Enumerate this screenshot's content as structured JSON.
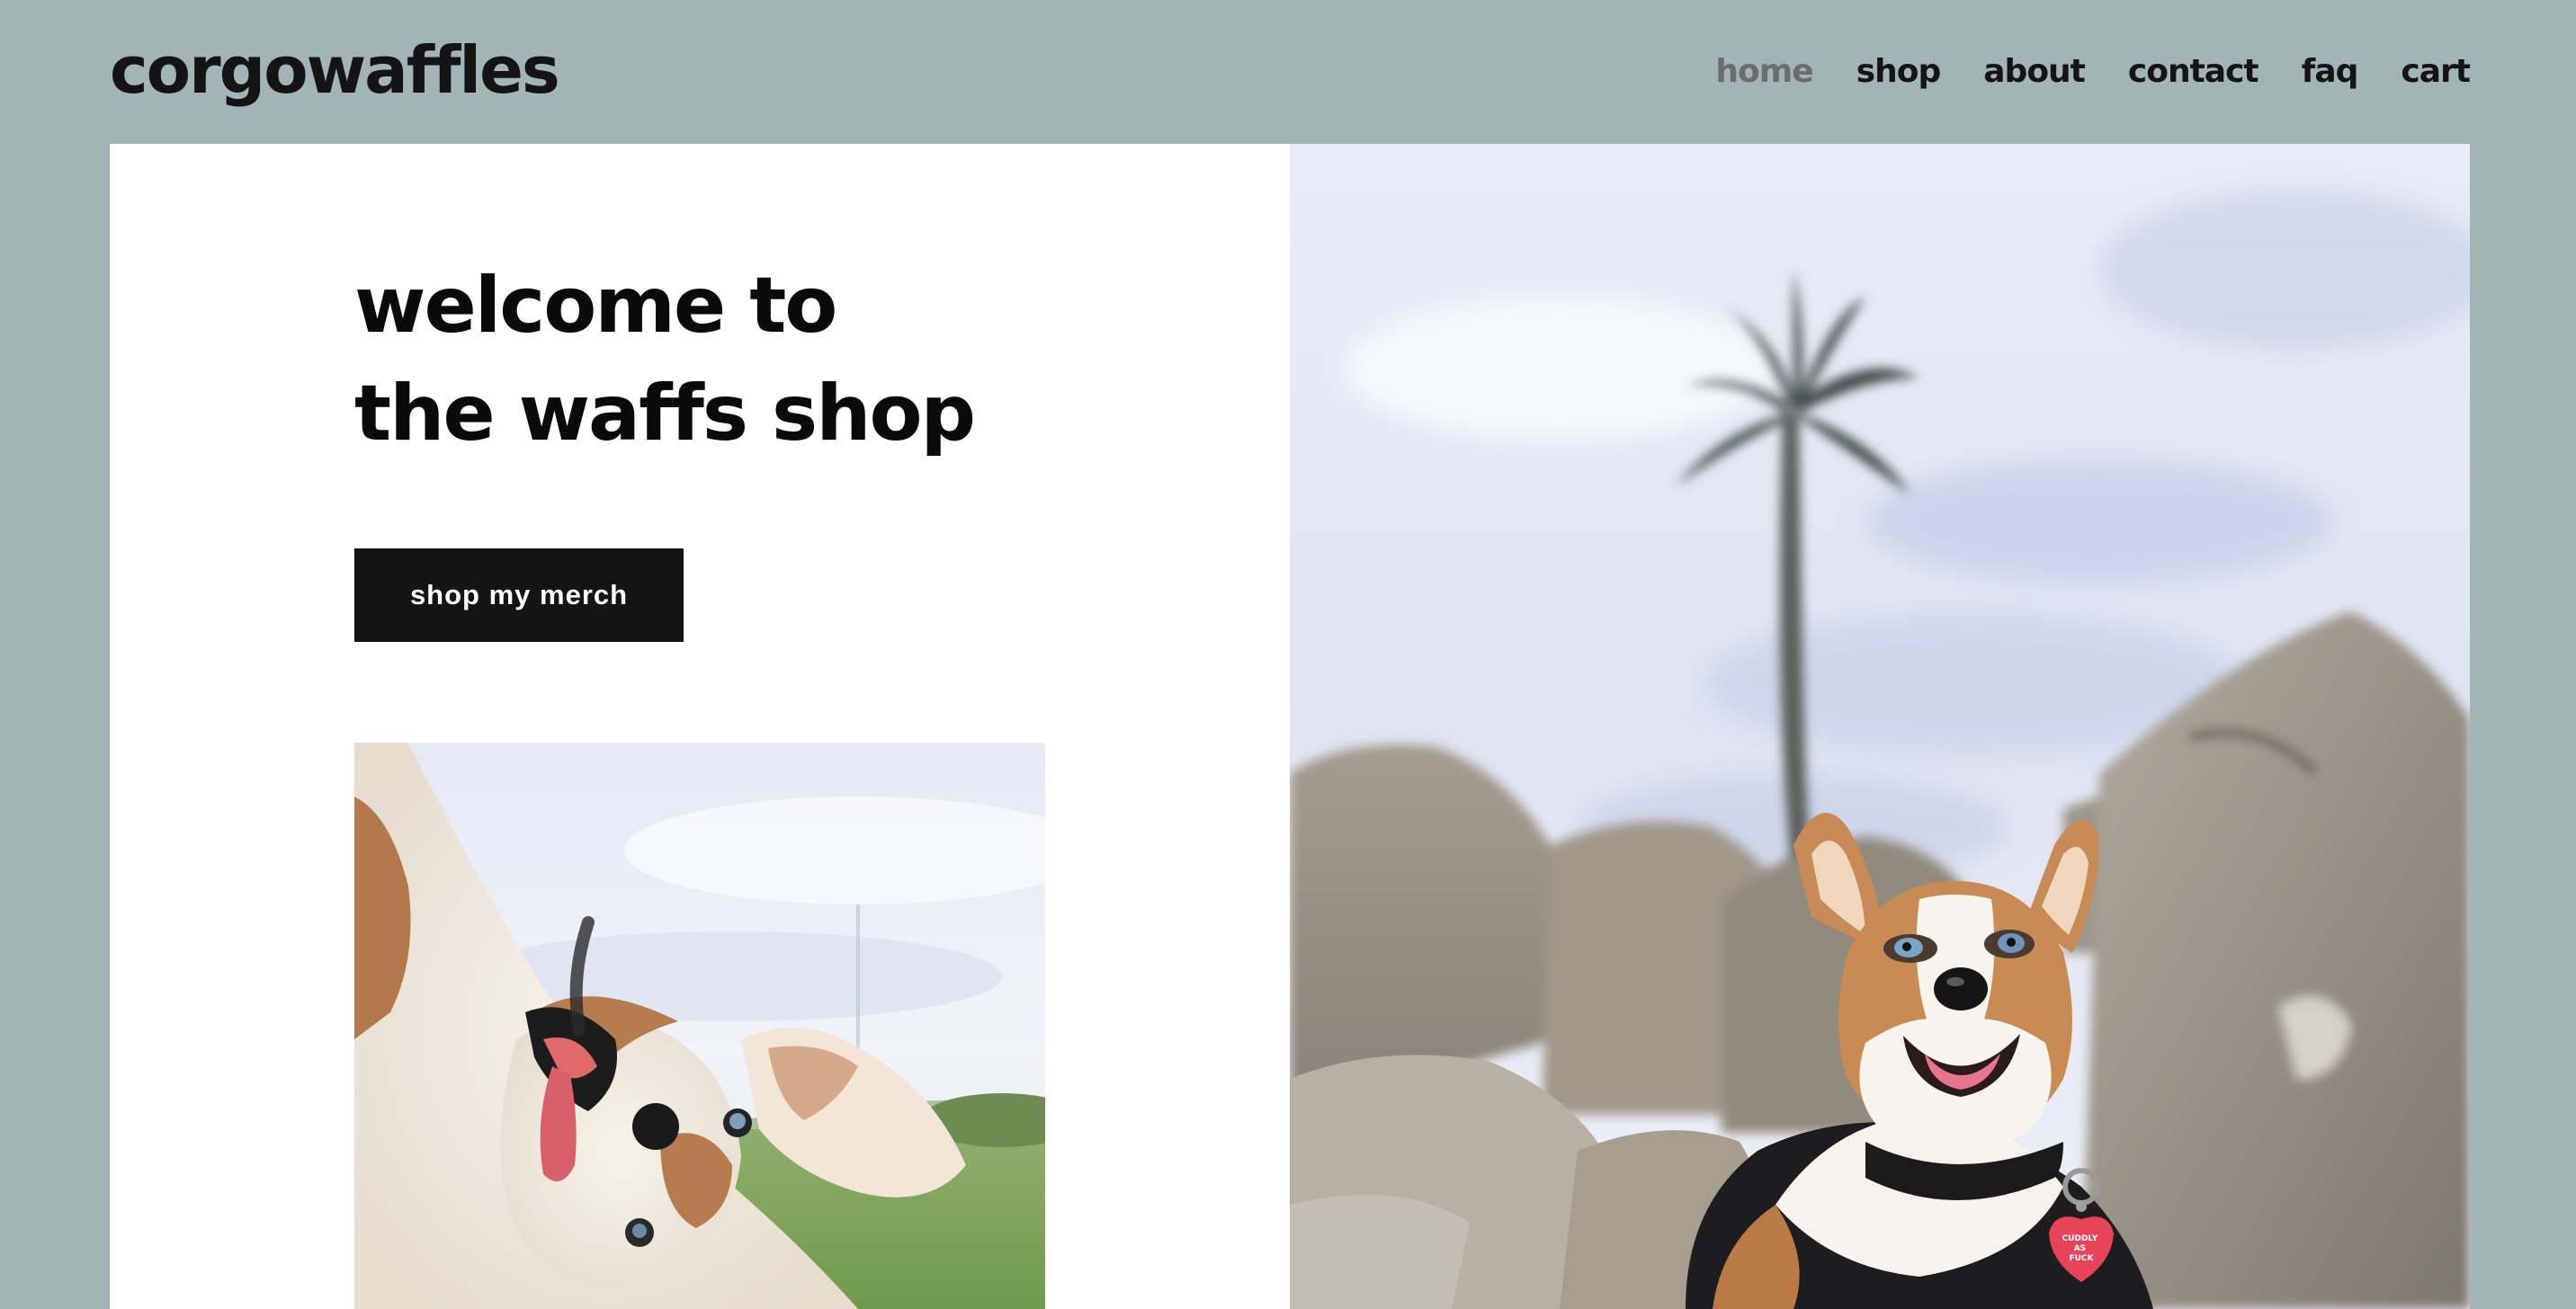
{
  "site": {
    "brand": "corgowaffles"
  },
  "nav": {
    "items": [
      {
        "label": "home",
        "active": true
      },
      {
        "label": "shop",
        "active": false
      },
      {
        "label": "about",
        "active": false
      },
      {
        "label": "contact",
        "active": false
      },
      {
        "label": "faq",
        "active": false
      },
      {
        "label": "cart",
        "active": false
      }
    ]
  },
  "hero": {
    "headline_line1": "welcome to",
    "headline_line2": "the waffs shop",
    "cta_label": "shop my merch"
  },
  "photos": {
    "hero_tag_text": "CUDDLY AS FUCK"
  },
  "colors": {
    "page_background": "#a2b4b6",
    "panel_background": "#ffffff",
    "text": "#141414",
    "nav_active": "#6c6c6c",
    "button_background": "#141414",
    "button_text": "#ffffff"
  }
}
